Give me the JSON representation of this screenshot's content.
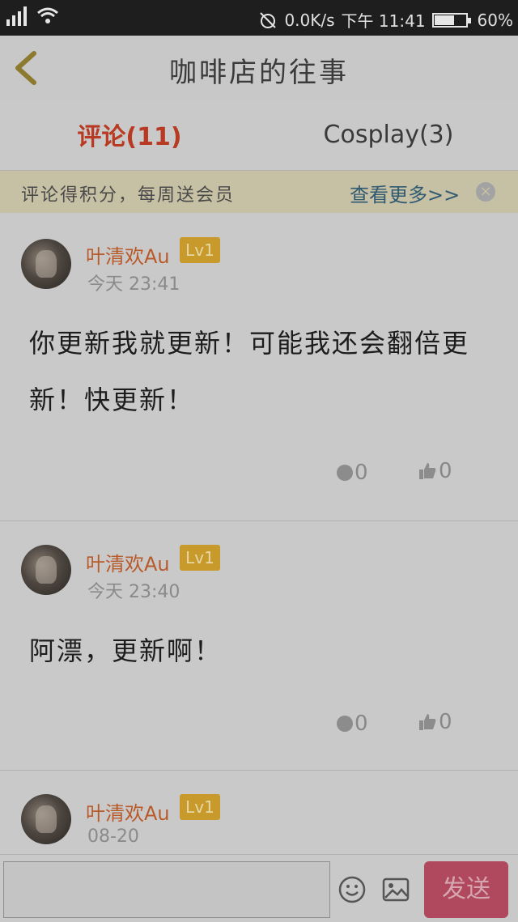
{
  "status": {
    "network": "0.0K/s",
    "time": "下午 11:41",
    "battery": "60%"
  },
  "header": {
    "title": "咖啡店的往事"
  },
  "tabs": [
    {
      "label": "评论(11)",
      "active": true
    },
    {
      "label": "Cosplay(3)",
      "active": false
    }
  ],
  "banner": {
    "text": "评论得积分，每周送会员",
    "more": "查看更多>>",
    "close": "×"
  },
  "comments": [
    {
      "user": "叶清欢Au",
      "level": "Lv1",
      "time": "今天 23:41",
      "text": "你更新我就更新！可能我还会翻倍更新！快更新！",
      "replies": "0",
      "likes": "0"
    },
    {
      "user": "叶清欢Au",
      "level": "Lv1",
      "time": "今天 23:40",
      "text": "阿漂，更新啊！",
      "replies": "0",
      "likes": "0"
    },
    {
      "user": "叶清欢Au",
      "level": "Lv1",
      "time": "08-20"
    }
  ],
  "inputbar": {
    "placeholder": "",
    "send_label": "发送"
  },
  "colors": {
    "accent_red": "#b83a22",
    "send_button": "#b0485e",
    "level_badge": "#c79a2b",
    "username": "#b85a2a"
  }
}
